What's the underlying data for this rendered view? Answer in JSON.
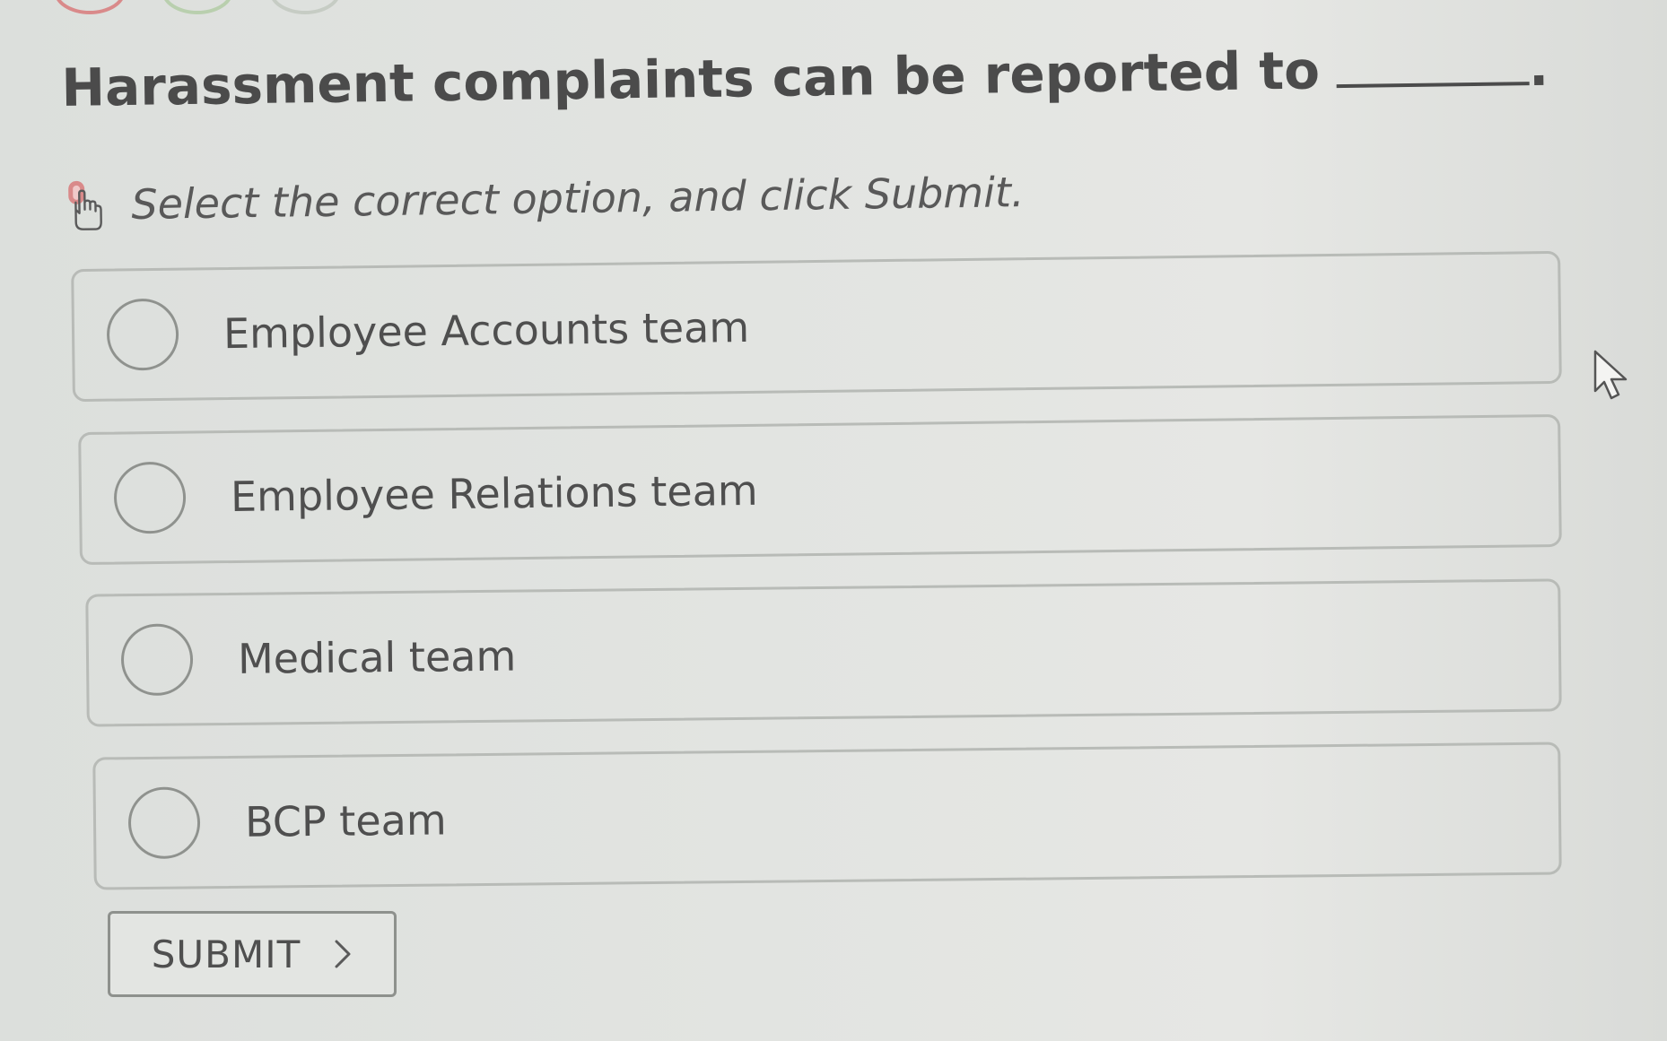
{
  "question": {
    "text": "Harassment complaints can be reported to",
    "period": "."
  },
  "instruction": {
    "text": "Select the correct option, and click Submit.",
    "icon": "pointer-hand-icon"
  },
  "options": [
    {
      "label": "Employee Accounts team"
    },
    {
      "label": "Employee Relations team"
    },
    {
      "label": "Medical team"
    },
    {
      "label": "BCP team"
    }
  ],
  "submit": {
    "label": "SUBMIT",
    "icon": "chevron-right-icon"
  },
  "colors": {
    "background": "#e2e4e1",
    "text": "#4b4b4b",
    "border": "#b8bbb7",
    "hand_accent": "#d98a8a"
  }
}
